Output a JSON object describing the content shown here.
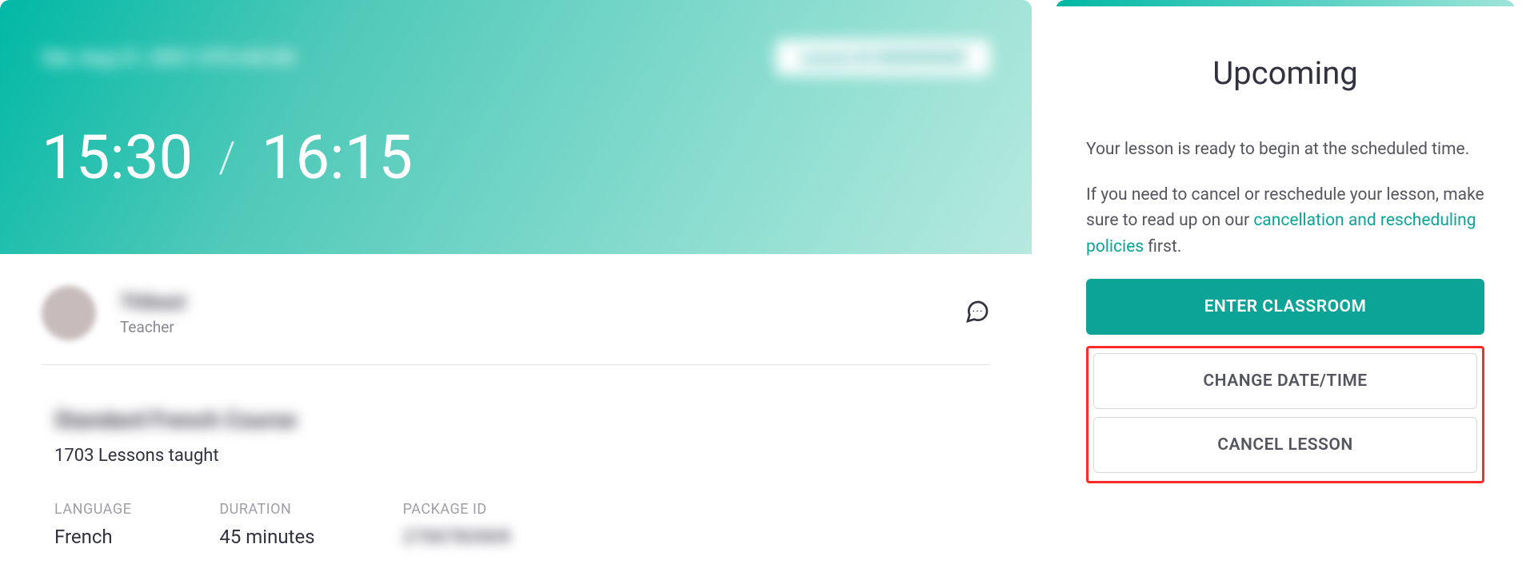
{
  "hero": {
    "date_text": "Sat, Aug 21, 2021 UTC+02:00",
    "lesson_id_text": "Lesson ID  0000000000",
    "start_time": "15:30",
    "end_time": "16:15"
  },
  "teacher": {
    "name": "Thibaut",
    "role": "Teacher"
  },
  "course": {
    "title": "Standard French Course",
    "lessons_taught": "1703 Lessons taught",
    "language_label": "LANGUAGE",
    "language_value": "French",
    "duration_label": "DURATION",
    "duration_value": "45 minutes",
    "package_label": "PACKAGE ID",
    "package_value": "2700783909"
  },
  "sidebar": {
    "title": "Upcoming",
    "p1": "Your lesson is ready to begin at the scheduled time.",
    "p2_pre": "If you need to cancel or reschedule your lesson, make sure to read up on our ",
    "p2_link": "cancellation and rescheduling policies",
    "p2_post": " first.",
    "btn_enter": "ENTER CLASSROOM",
    "btn_change": "CHANGE DATE/TIME",
    "btn_cancel": "CANCEL LESSON"
  }
}
